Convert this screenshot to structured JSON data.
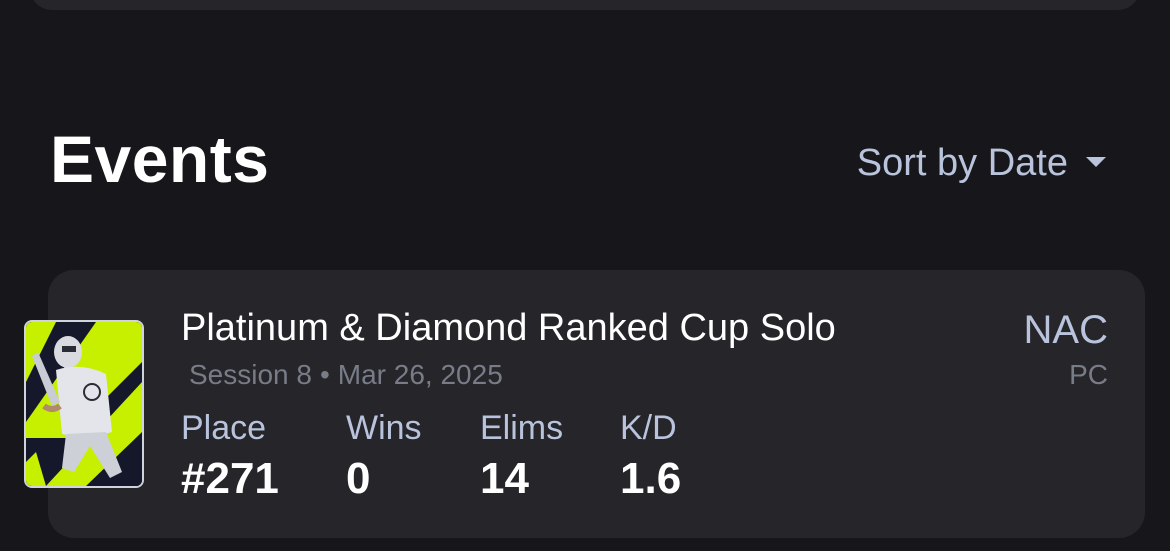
{
  "events_section": {
    "title": "Events",
    "sort_label": "Sort by Date",
    "sort_icon": "chevron-down-icon"
  },
  "event": {
    "thumbnail_icon": "skin-thumbnail",
    "name": "Platinum & Diamond Ranked Cup Solo",
    "session": "Session 8",
    "separator": "•",
    "date": "Mar 26, 2025",
    "region": "NAC",
    "platform": "PC",
    "stats": [
      {
        "label": "Place",
        "value": "#271"
      },
      {
        "label": "Wins",
        "value": "0"
      },
      {
        "label": "Elims",
        "value": "14"
      },
      {
        "label": "K/D",
        "value": "1.6"
      }
    ]
  },
  "colors": {
    "background": "#17171b",
    "card": "#25252a",
    "accent_text": "#b9c4dc",
    "muted_text": "#787c87",
    "thumbnail_green": "#c6f000"
  }
}
